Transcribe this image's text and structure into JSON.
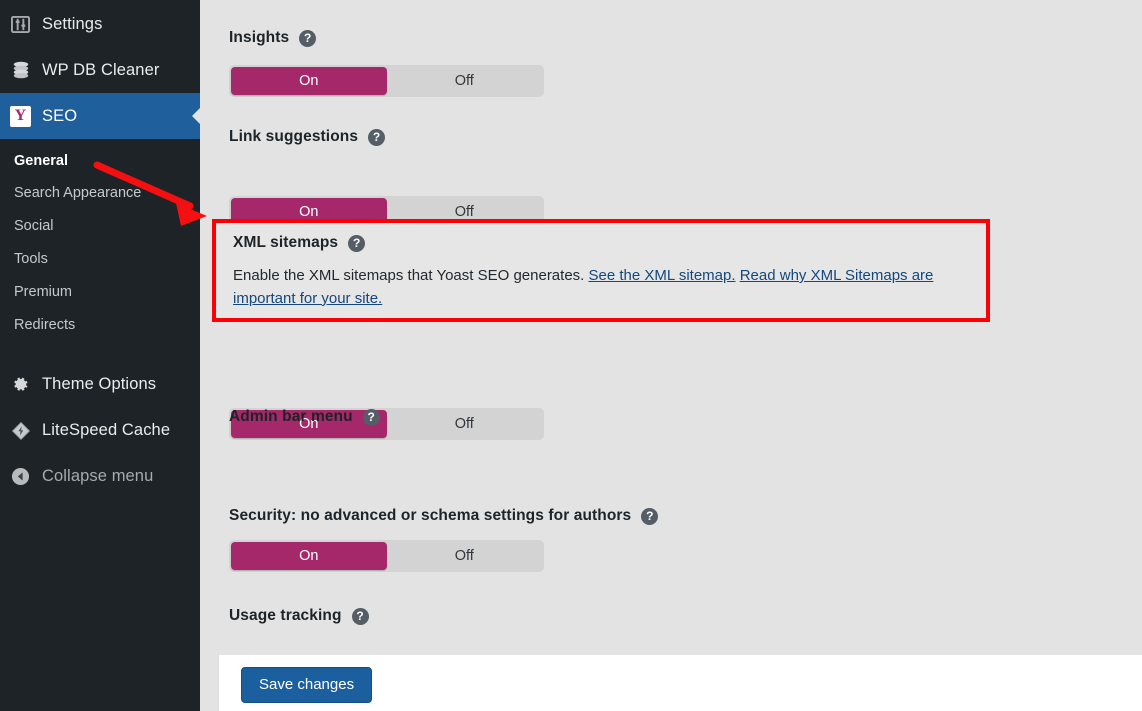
{
  "sidebar": {
    "items": [
      {
        "label": "Settings",
        "icon": "sliders-icon"
      },
      {
        "label": "WP DB Cleaner",
        "icon": "database-icon"
      },
      {
        "label": "SEO",
        "icon": "yoast-logo",
        "active": true
      }
    ],
    "submenu": [
      {
        "label": "General",
        "current": true
      },
      {
        "label": "Search Appearance"
      },
      {
        "label": "Social"
      },
      {
        "label": "Tools"
      },
      {
        "label": "Premium"
      },
      {
        "label": "Redirects"
      }
    ],
    "bottom_items": [
      {
        "label": "Theme Options",
        "icon": "gear-icon"
      },
      {
        "label": "LiteSpeed Cache",
        "icon": "diamond-icon"
      },
      {
        "label": "Collapse menu",
        "icon": "collapse-arrow-icon"
      }
    ]
  },
  "settings": {
    "help_glyph": "?",
    "toggle": {
      "on_label": "On",
      "off_label": "Off"
    },
    "fields": [
      {
        "label": "Insights",
        "state": "On"
      },
      {
        "label": "Link suggestions",
        "state": "On"
      },
      {
        "label": "XML sitemaps",
        "state": "On"
      },
      {
        "label": "Admin bar menu",
        "state": "On"
      },
      {
        "label": "Security: no advanced or schema settings for authors",
        "state": "On"
      },
      {
        "label": "Usage tracking",
        "state": "On"
      }
    ]
  },
  "highlight": {
    "title": "XML sitemaps",
    "description_prefix": "Enable the XML sitemaps that Yoast SEO generates. ",
    "link_one": "See the XML sitemap.",
    "description_mid": " ",
    "link_two": "Read why XML Sitemaps are important for your site.",
    "border_color": "#fb0007"
  },
  "footer": {
    "save_label": "Save changes",
    "save_color": "#1c5f9e"
  },
  "annotation": {
    "arrow_color": "#f41010"
  },
  "colors": {
    "accent_magenta": "#a4286a",
    "sidebar_bg": "#1d2327",
    "active_blue": "#1f5f9c",
    "content_bg": "#e3e3e3"
  }
}
